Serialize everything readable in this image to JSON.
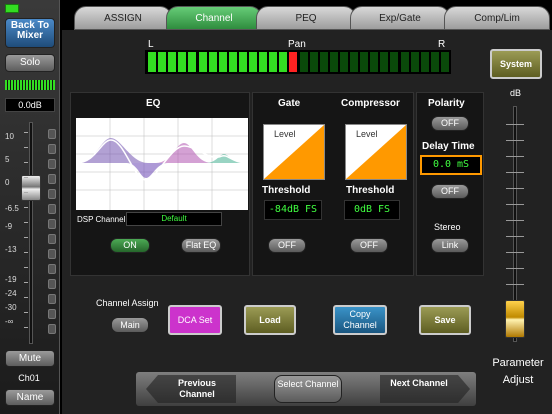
{
  "left_strip": {
    "back_label": "Back To Mixer",
    "solo_label": "Solo",
    "gain_readout": "0.0dB",
    "fader_ticks": [
      "10",
      "5",
      "0",
      "-6.5",
      "-9",
      "-13",
      "-19",
      "-24",
      "-30",
      "-∞"
    ],
    "mute_label": "Mute",
    "channel_name": "Ch01",
    "name_button_label": "Name"
  },
  "tabs": [
    "ASSIGN",
    "Channel",
    "PEQ",
    "Exp/Gate",
    "Comp/Lim"
  ],
  "active_tab": "Channel",
  "pan": {
    "left_label": "L",
    "center_label": "Pan",
    "right_label": "R"
  },
  "system_button_label": "System",
  "db_label": "dB",
  "eq": {
    "title": "EQ",
    "dsp_channel_label": "DSP Channel",
    "dsp_channel_value": "Default",
    "on_label": "ON",
    "flat_label": "Flat EQ"
  },
  "gate": {
    "title": "Gate",
    "level_label": "Level",
    "threshold_label": "Threshold",
    "threshold_value": "-84dB FS",
    "toggle_label": "OFF"
  },
  "compressor": {
    "title": "Compressor",
    "level_label": "Level",
    "threshold_label": "Threshold",
    "threshold_value": "0dB FS",
    "toggle_label": "OFF"
  },
  "polarity": {
    "title": "Polarity",
    "toggle_label": "OFF"
  },
  "delay": {
    "title": "Delay Time",
    "value": "0.0 mS",
    "toggle_label": "OFF"
  },
  "stereo": {
    "label": "Stereo",
    "link_label": "Link"
  },
  "assign": {
    "label": "Channel Assign",
    "main_label": "Main",
    "dca_label": "DCA Set",
    "load_label": "Load",
    "copy_label": "Copy Channel",
    "save_label": "Save"
  },
  "navigation": {
    "prev_label": "Previous Channel",
    "select_label": "Select Channel",
    "next_label": "Next Channel"
  },
  "parameter_adjust_label": "Parameter Adjust",
  "colors": {
    "tab_active": "#2f8d3e",
    "meter_green": "#33dd22",
    "meter_red": "#ff2222",
    "dca_magenta": "#cc33cc",
    "copy_teal": "#2277aa",
    "olive": "#8c8c3c",
    "orange": "#ff9900",
    "digital_green": "#40ff40"
  }
}
